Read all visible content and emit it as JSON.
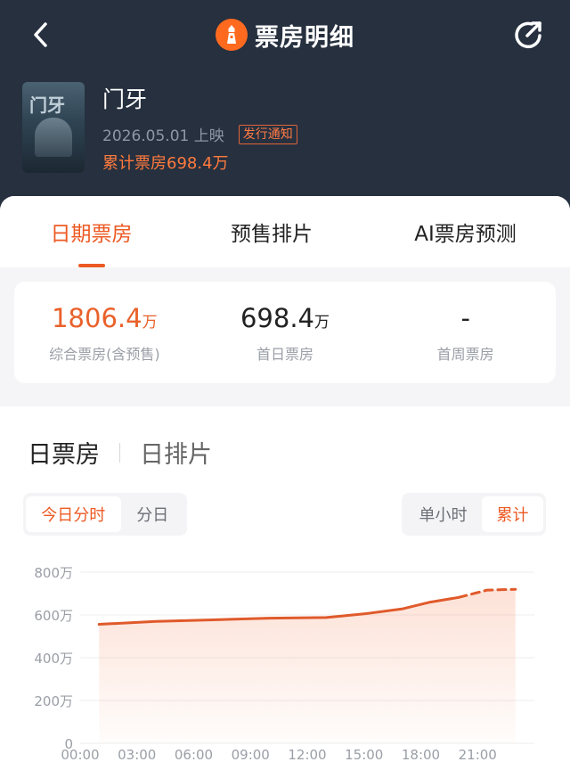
{
  "nav": {
    "title": "票房明细",
    "back_icon": "chevron-left-icon",
    "share_icon": "share-icon",
    "logo_icon": "lighthouse-icon"
  },
  "movie": {
    "poster_text": "门牙",
    "name": "门牙",
    "release": "2026.05.01 上映",
    "badge": "发行通知",
    "cumulative": "累计票房698.4万"
  },
  "tabs": [
    {
      "label": "日期票房",
      "active": true
    },
    {
      "label": "预售排片",
      "active": false
    },
    {
      "label": "AI票房预测",
      "active": false
    }
  ],
  "stats": [
    {
      "value": "1806.4",
      "unit": "万",
      "label": "综合票房(含预售)"
    },
    {
      "value": "698.4",
      "unit": "万",
      "label": "首日票房"
    },
    {
      "value": "-",
      "unit": "",
      "label": "首周票房"
    }
  ],
  "section": {
    "primary": "日票房",
    "secondary": "日排片"
  },
  "left_toggle": [
    "今日分时",
    "分日"
  ],
  "right_toggle": [
    "单小时",
    "累计"
  ],
  "colors": {
    "header_bg": "#26303f",
    "accent": "#ec5a24",
    "line": "#e05a2b"
  },
  "chart_data": {
    "type": "area",
    "ylim": [
      0,
      800
    ],
    "y_ticks": [
      "0",
      "200万",
      "400万",
      "600万",
      "800万"
    ],
    "x_ticks": [
      "00:00",
      "03:00",
      "06:00",
      "09:00",
      "12:00",
      "15:00",
      "18:00",
      "21:00"
    ],
    "series": [
      {
        "values": [
          {
            "x": "01:00",
            "y": 556
          },
          {
            "x": "04:00",
            "y": 570
          },
          {
            "x": "07:00",
            "y": 577
          },
          {
            "x": "10:00",
            "y": 585
          },
          {
            "x": "13:00",
            "y": 588
          },
          {
            "x": "15:00",
            "y": 605
          },
          {
            "x": "17:00",
            "y": 628
          },
          {
            "x": "18:30",
            "y": 660
          },
          {
            "x": "20:00",
            "y": 682
          }
        ]
      },
      {
        "style": "dashed",
        "values": [
          {
            "x": "20:00",
            "y": 682
          },
          {
            "x": "21:30",
            "y": 716
          },
          {
            "x": "23:00",
            "y": 720
          }
        ]
      }
    ]
  }
}
